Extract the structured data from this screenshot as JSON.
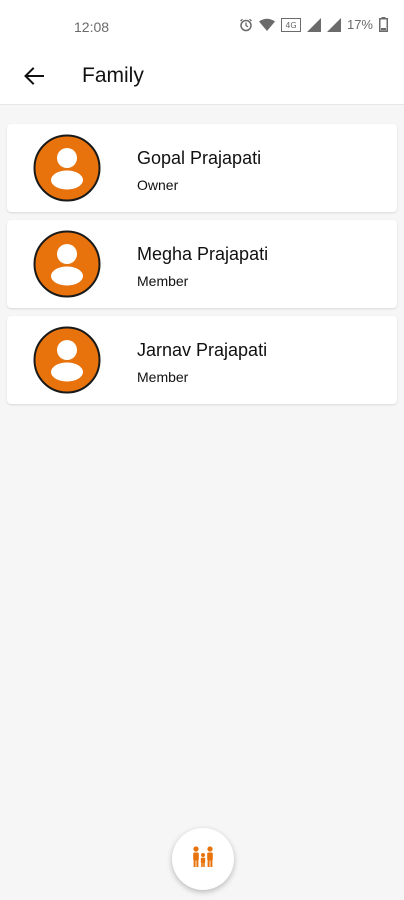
{
  "status_bar": {
    "time": "12:08",
    "battery": "17%",
    "icons": [
      "alarm-icon",
      "wifi-icon",
      "volte-icon",
      "signal-icon",
      "signal-icon",
      "battery-icon"
    ]
  },
  "app_bar": {
    "back_icon": "arrow-left-icon",
    "title": "Family"
  },
  "members": [
    {
      "name": "Gopal Prajapati",
      "role": "Owner"
    },
    {
      "name": "Megha Prajapati",
      "role": "Member"
    },
    {
      "name": "Jarnav Prajapati",
      "role": "Member"
    }
  ],
  "fab": {
    "icon": "family-icon"
  },
  "colors": {
    "accent": "#e8720c",
    "background": "#f6f6f6",
    "card": "#ffffff"
  }
}
